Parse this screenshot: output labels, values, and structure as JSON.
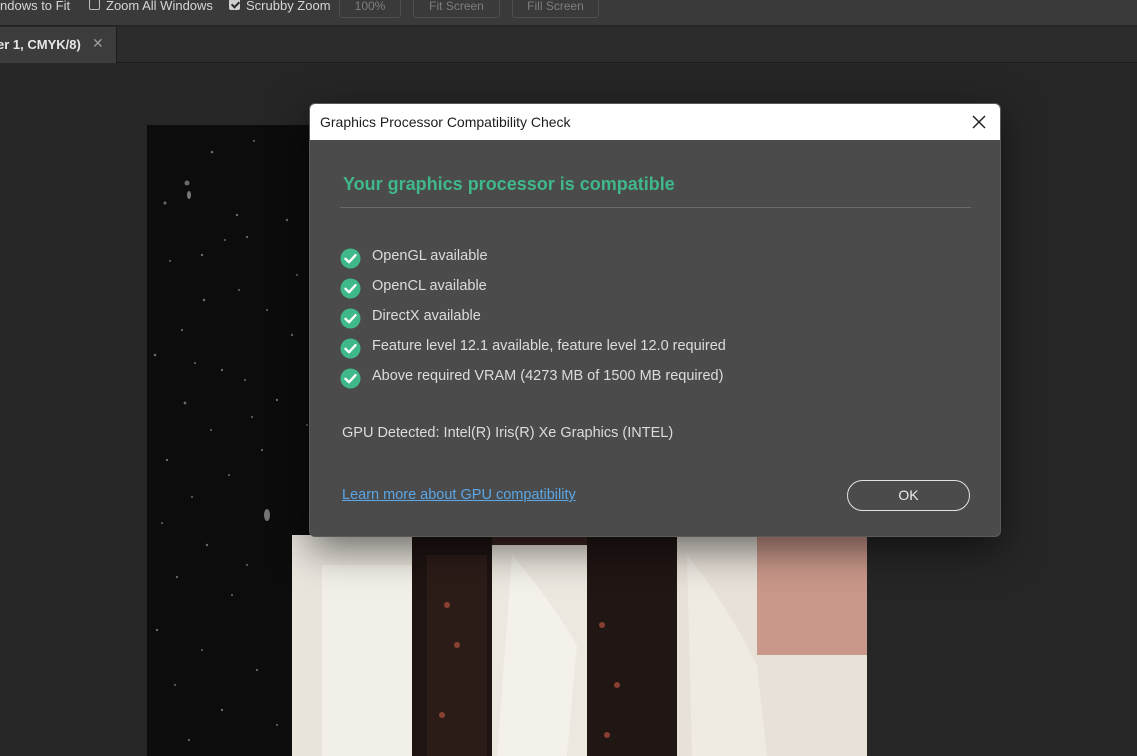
{
  "options_bar": {
    "resize_windows_label": "ndows to Fit",
    "zoom_all_windows_label": "Zoom All Windows",
    "zoom_all_windows_checked": false,
    "scrubby_zoom_label": "Scrubby Zoom",
    "scrubby_zoom_checked": true,
    "zoom_value": "100%",
    "fit_screen_label": "Fit Screen",
    "fill_screen_label": "Fill Screen"
  },
  "tabs": [
    {
      "label": "er 1, CMYK/8)",
      "close_icon": "close-icon",
      "active": true
    }
  ],
  "dialog": {
    "title": "Graphics Processor Compatibility Check",
    "heading": "Your graphics processor is compatible",
    "checks": [
      {
        "label": "OpenGL available",
        "status": "pass"
      },
      {
        "label": "OpenCL available",
        "status": "pass"
      },
      {
        "label": "DirectX available",
        "status": "pass"
      },
      {
        "label": "Feature level 12.1 available, feature level 12.0 required",
        "status": "pass"
      },
      {
        "label": "Above required VRAM (4273 MB of 1500 MB required)",
        "status": "pass"
      }
    ],
    "gpu_detected": "GPU Detected: Intel(R) Iris(R) Xe Graphics (INTEL)",
    "learn_more_link": "Learn more about GPU compatibility",
    "ok_label": "OK"
  },
  "colors": {
    "accent_green": "#3fb88a",
    "link_blue": "#5aa6e6",
    "dialog_bg": "#4b4b4b"
  }
}
